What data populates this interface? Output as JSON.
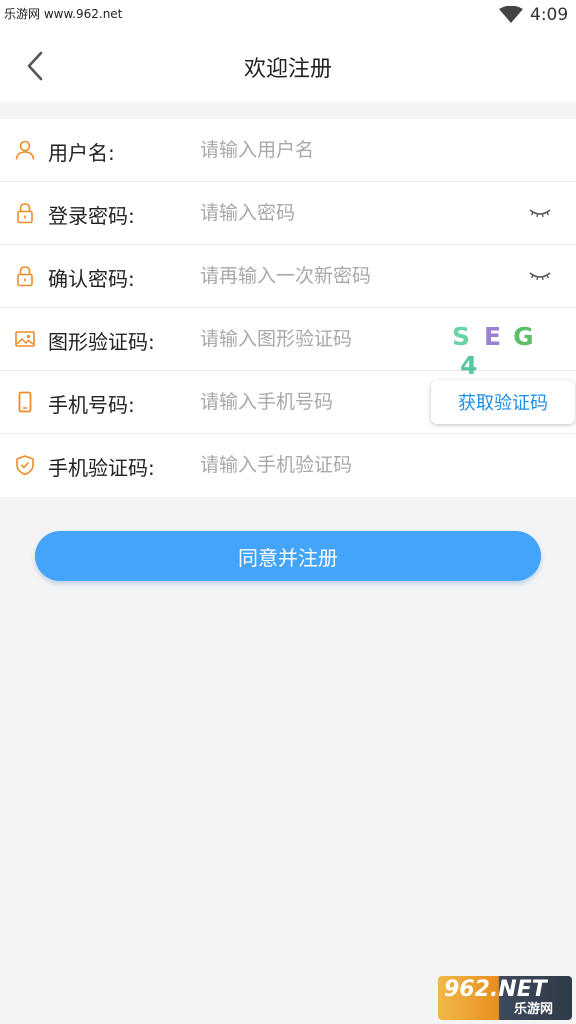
{
  "status_bar": {
    "watermark": "乐游网 www.962.net",
    "time": "4:09",
    "wifi_icon": "wifi-icon"
  },
  "header": {
    "title": "欢迎注册",
    "back_icon": "chevron-left-icon"
  },
  "form": {
    "rows": [
      {
        "label": "用户名:",
        "placeholder": "请输入用户名",
        "icon": "user-icon"
      },
      {
        "label": "登录密码:",
        "placeholder": "请输入密码",
        "icon": "lock-icon",
        "trailing_icon": "eye-closed-icon"
      },
      {
        "label": "确认密码:",
        "placeholder": "请再输入一次新密码",
        "icon": "lock-icon",
        "trailing_icon": "eye-closed-icon"
      },
      {
        "label": "图形验证码:",
        "placeholder": "请输入图形验证码",
        "icon": "image-icon",
        "captcha_text": "SEG4"
      },
      {
        "label": "手机号码:",
        "placeholder": "请输入手机号码",
        "icon": "phone-icon",
        "button_label": "获取验证码"
      },
      {
        "label": "手机验证码:",
        "placeholder": "请输入手机验证码",
        "icon": "shield-check-icon"
      }
    ]
  },
  "submit": {
    "label": "同意并注册"
  },
  "watermark_bottom": {
    "big": "962.NET",
    "small": "乐游网"
  },
  "colors": {
    "accent": "#44a4f9",
    "icon_orange": "#f08c28",
    "link_blue": "#1e8ee6",
    "background": "#f4f4f4"
  }
}
